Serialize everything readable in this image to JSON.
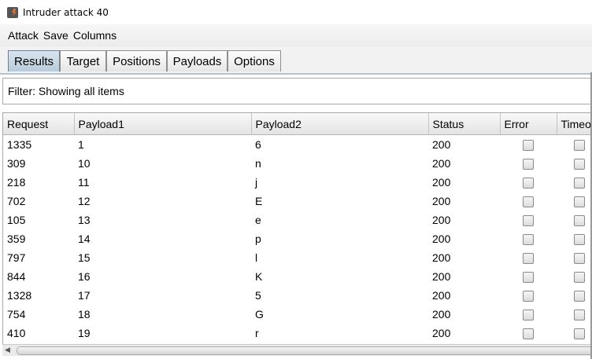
{
  "window": {
    "title": "Intruder attack 40"
  },
  "menu": [
    "Attack",
    "Save",
    "Columns"
  ],
  "tabs": [
    {
      "label": "Results",
      "active": true
    },
    {
      "label": "Target",
      "active": false
    },
    {
      "label": "Positions",
      "active": false
    },
    {
      "label": "Payloads",
      "active": false
    },
    {
      "label": "Options",
      "active": false
    }
  ],
  "filter": {
    "text": "Filter: Showing all items"
  },
  "table": {
    "columns": [
      "Request",
      "Payload1",
      "Payload2",
      "Status",
      "Error",
      "Timeo"
    ],
    "rows": [
      {
        "request": "1335",
        "payload1": "1",
        "payload2": "6",
        "status": "200",
        "error": false,
        "timeout": false
      },
      {
        "request": "309",
        "payload1": "10",
        "payload2": "n",
        "status": "200",
        "error": false,
        "timeout": false
      },
      {
        "request": "218",
        "payload1": "11",
        "payload2": "j",
        "status": "200",
        "error": false,
        "timeout": false
      },
      {
        "request": "702",
        "payload1": "12",
        "payload2": "E",
        "status": "200",
        "error": false,
        "timeout": false
      },
      {
        "request": "105",
        "payload1": "13",
        "payload2": "e",
        "status": "200",
        "error": false,
        "timeout": false
      },
      {
        "request": "359",
        "payload1": "14",
        "payload2": "p",
        "status": "200",
        "error": false,
        "timeout": false
      },
      {
        "request": "797",
        "payload1": "15",
        "payload2": "l",
        "status": "200",
        "error": false,
        "timeout": false
      },
      {
        "request": "844",
        "payload1": "16",
        "payload2": "K",
        "status": "200",
        "error": false,
        "timeout": false
      },
      {
        "request": "1328",
        "payload1": "17",
        "payload2": "5",
        "status": "200",
        "error": false,
        "timeout": false
      },
      {
        "request": "754",
        "payload1": "18",
        "payload2": "G",
        "status": "200",
        "error": false,
        "timeout": false
      },
      {
        "request": "410",
        "payload1": "19",
        "payload2": "r",
        "status": "200",
        "error": false,
        "timeout": false
      }
    ]
  }
}
